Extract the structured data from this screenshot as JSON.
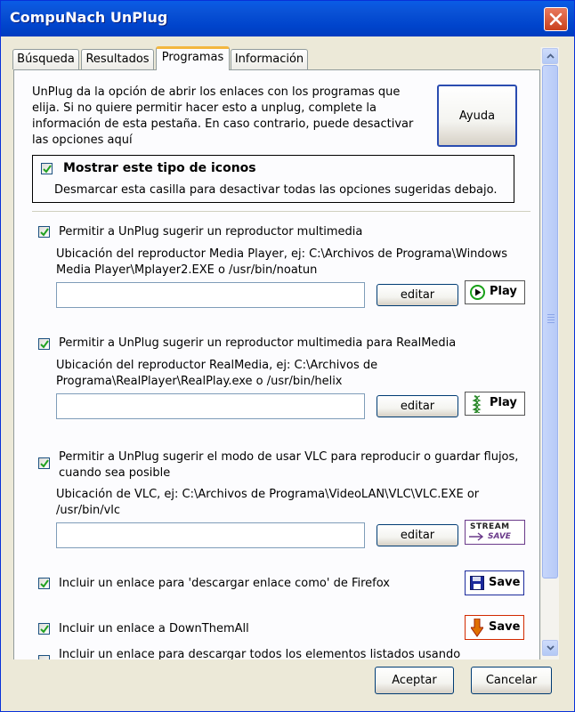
{
  "window": {
    "title": "CompuNach UnPlug"
  },
  "tabs": [
    {
      "label": "Búsqueda"
    },
    {
      "label": "Resultados"
    },
    {
      "label": "Programas"
    },
    {
      "label": "Información"
    }
  ],
  "intro": {
    "lines": [
      "UnPlug da la opción de abrir los enlaces con los programas que",
      "elija. Si no quiere permitir hacer esto a unplug, complete la",
      "información de esta pestaña. En caso contrario, puede desactivar",
      "las opciones aquí"
    ],
    "help_button": "Ayuda"
  },
  "show_icons": {
    "label": "Mostrar este tipo de iconos",
    "hint": "Desmarcar esta casilla para desactivar todas las opciones sugeridas debajo.",
    "checked": true
  },
  "media_player": {
    "label": "Permitir a UnPlug sugerir un reproductor multimedia",
    "location_lines": [
      "Ubicación del reproductor Media Player, ej: C:\\Archivos de Programa\\Windows",
      "Media Player\\Mplayer2.EXE o /usr/bin/noatun"
    ],
    "value": "",
    "edit_button": "editar",
    "badge": "Play",
    "checked": true
  },
  "real_media": {
    "label": "Permitir a UnPlug sugerir un reproductor multimedia para RealMedia",
    "location_lines": [
      "Ubicación del reproductor RealMedia, ej: C:\\Archivos de",
      "Programa\\RealPlayer\\RealPlay.exe o /usr/bin/helix"
    ],
    "value": "",
    "edit_button": "editar",
    "badge": "Play",
    "checked": true
  },
  "vlc": {
    "label_lines": [
      "Permitir a UnPlug sugerir el modo de usar VLC para reproducir o guardar flujos,",
      "cuando sea posible"
    ],
    "location_lines": [
      "Ubicación de VLC, ej: C:\\Archivos de Programa\\VideoLAN\\VLC\\VLC.EXE or",
      "/usr/bin/vlc"
    ],
    "value": "",
    "edit_button": "editar",
    "badge_top": "STREAM",
    "badge_bottom": "SAVE",
    "checked": true
  },
  "firefox_save": {
    "label": "Incluir un enlace para 'descargar enlace como' de Firefox",
    "badge": "Save",
    "checked": true
  },
  "downthemall": {
    "label": "Incluir un enlace a DownThemAll",
    "badge": "Save",
    "checked": true
  },
  "download_all": {
    "label": "Incluir un enlace para descargar todos los elementos listados usando"
  },
  "footer": {
    "accept": "Aceptar",
    "cancel": "Cancelar"
  },
  "colors": {
    "titlebar": "#0a52d6",
    "checkmark": "#21a121",
    "play_green": "#18a018",
    "save_blue": "#1b2a9c",
    "save_red": "#d22a00",
    "stream_purple": "#6a3a8a"
  }
}
